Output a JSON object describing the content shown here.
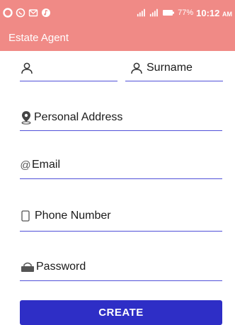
{
  "status_bar": {
    "battery": "77%",
    "time": "10:12",
    "ampm": "AM",
    "icons": [
      "opera-icon",
      "whatsapp-icon",
      "mail-icon",
      "music-icon",
      "signal-icon",
      "signal-icon",
      "battery-icon"
    ]
  },
  "app_bar": {
    "title": "Estate Agent"
  },
  "form": {
    "first_name_placeholder": "",
    "surname_placeholder": "Surname",
    "address_placeholder": "Personal Address",
    "email_placeholder": "Email",
    "phone_placeholder": "Phone Number",
    "password_placeholder": "Password",
    "create_label": "CREATE"
  },
  "colors": {
    "accent": "#f08a86",
    "button": "#2e2ec6",
    "underline": "#5050d8"
  }
}
